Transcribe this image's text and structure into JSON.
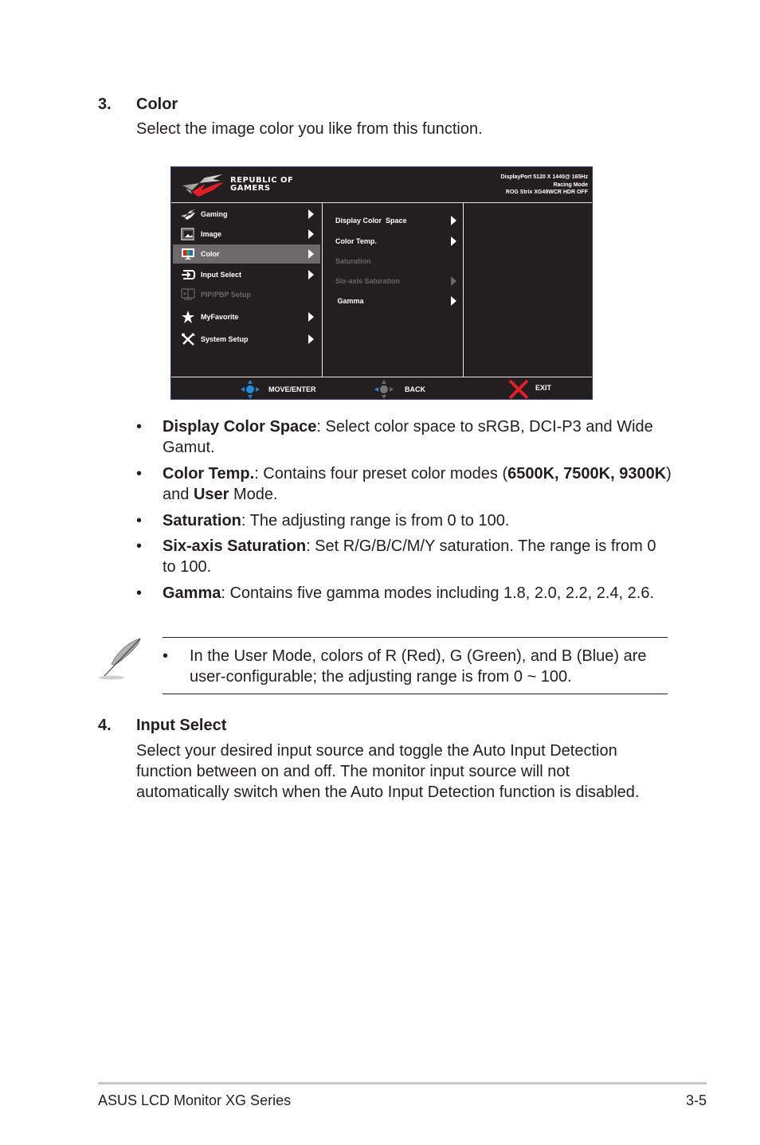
{
  "section3": {
    "number": "3.",
    "title": "Color",
    "description": "Select the image color you like from this function."
  },
  "osd": {
    "brand_line1": "REPUBLIC OF",
    "brand_line2": "GAMERS",
    "status": {
      "line1": "DisplayPort 5120 X 1440@ 165Hz",
      "line2": "Racing Mode",
      "line3": "ROG Strix XG49WCR HDR OFF"
    },
    "main_menu": [
      {
        "label": "Gaming",
        "icon": "rog-eye-icon",
        "state": "normal",
        "has_arrow": true
      },
      {
        "label": "Image",
        "icon": "image-icon",
        "state": "normal",
        "has_arrow": true
      },
      {
        "label": "Color",
        "icon": "monitor-rgb-icon",
        "state": "selected",
        "has_arrow": true
      },
      {
        "label": "Input Select",
        "icon": "input-icon",
        "state": "normal",
        "has_arrow": true
      },
      {
        "label": "PIP/PBP Setup",
        "icon": "pip-icon",
        "state": "disabled",
        "has_arrow": false
      },
      {
        "label": "MyFavorite",
        "icon": "star-icon",
        "state": "normal",
        "has_arrow": true
      },
      {
        "label": "System Setup",
        "icon": "tools-icon",
        "state": "normal",
        "has_arrow": true
      }
    ],
    "sub_menu": [
      {
        "label": "Display Color  Space",
        "state": "normal",
        "has_arrow": true
      },
      {
        "label": "Color Temp.",
        "state": "normal",
        "has_arrow": true
      },
      {
        "label": "Saturation",
        "state": "disabled",
        "has_arrow": false
      },
      {
        "label": "Six-axis Saturation",
        "state": "disabled",
        "has_arrow": true
      },
      {
        "label": " Gamma",
        "state": "normal",
        "has_arrow": true
      }
    ],
    "footer": {
      "move_label": "MOVE/ENTER",
      "back_label": "BACK",
      "exit_label": "EXIT"
    },
    "colors": {
      "background": "#231f20",
      "selected": "#6d6a6c",
      "disabled_text": "#6a6768",
      "accent_red": "#e31e24",
      "nav_blue": "#2f7fd1"
    }
  },
  "bullets": [
    {
      "parts": [
        {
          "b": "Display Color Space"
        },
        {
          "t": ": Select color space to sRGB, DCI-P3 and Wide Gamut."
        }
      ]
    },
    {
      "parts": [
        {
          "b": "Color Temp."
        },
        {
          "t": ": Contains four preset color modes ("
        },
        {
          "b": "6500K, 7500K, 9300K"
        },
        {
          "t": ") and "
        },
        {
          "b": "User"
        },
        {
          "t": " Mode."
        }
      ]
    },
    {
      "parts": [
        {
          "b": "Saturation"
        },
        {
          "t": ": The adjusting range is from 0 to 100."
        }
      ]
    },
    {
      "parts": [
        {
          "b": "Six-axis Saturation"
        },
        {
          "t": ": Set R/G/B/C/M/Y saturation. The range is from 0 to 100."
        }
      ]
    },
    {
      "parts": [
        {
          "b": "Gamma"
        },
        {
          "t": ": Contains five gamma modes including 1.8, 2.0, 2.2, 2.4, 2.6."
        }
      ]
    }
  ],
  "note": {
    "bullet": "•",
    "text": "In the User Mode, colors of R (Red), G (Green), and B (Blue) are user-configurable; the adjusting range is from 0 ~ 100."
  },
  "section4": {
    "number": "4.",
    "title": "Input Select",
    "description": "Select your desired input source and toggle the Auto Input Detection function between on and off. The monitor input source will not automatically switch when the Auto Input Detection function is disabled."
  },
  "page_footer": {
    "left": "ASUS LCD Monitor XG Series",
    "right": "3-5"
  }
}
